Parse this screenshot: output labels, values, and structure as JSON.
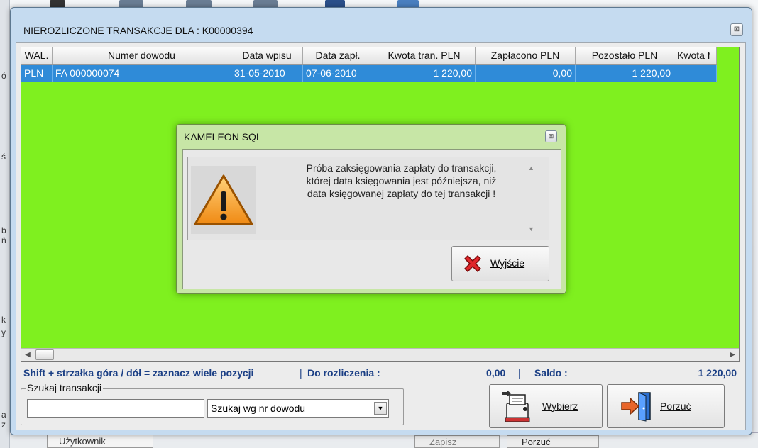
{
  "main_window": {
    "title": "NIEROZLICZONE TRANSAKCJE DLA : K00000394",
    "close_glyph": "⊠"
  },
  "grid": {
    "columns": [
      "WAL.",
      "Numer dowodu",
      "Data wpisu",
      "Data zapł.",
      "Kwota tran. PLN",
      "Zapłacono PLN",
      "Pozostało PLN",
      "Kwota f"
    ],
    "rows": [
      {
        "wal": "PLN",
        "numer": "FA 000000074",
        "data_wpisu": "31-05-2010",
        "data_zapl": "07-06-2010",
        "kwota": "1 220,00",
        "zaplacono": "0,00",
        "pozostalo": "1 220,00",
        "kwota_f": ""
      }
    ],
    "background_color": "#7ff01f",
    "selected_row_color": "#2f8bd8"
  },
  "status": {
    "hint": "Shift + strzałka góra / dół  = zaznacz wiele pozycji",
    "separator": "|",
    "do_rozliczenia_label": "Do rozliczenia :",
    "do_rozliczenia_value": "0,00",
    "saldo_label": "Saldo :",
    "saldo_value": "1 220,00"
  },
  "search": {
    "legend": "Szukaj transakcji",
    "input_value": "",
    "mode_selected": "Szukaj wg nr dowodu"
  },
  "buttons": {
    "wybierz": "Wybierz",
    "porzuc": "Porzuć"
  },
  "modal": {
    "title": "KAMELEON SQL",
    "message_lines": [
      "Próba zaksięgowania zapłaty do transakcji,",
      "której data księgowania  jest późniejsza, niż",
      "data księgowanej zapłaty do tej transakcji !"
    ],
    "exit_label": "Wyjście",
    "icon": "warning-icon"
  },
  "background_app": {
    "user_label": "Użytkownik",
    "button_zapisz": "Zapisz",
    "button_porzuc": "Porzuć"
  }
}
